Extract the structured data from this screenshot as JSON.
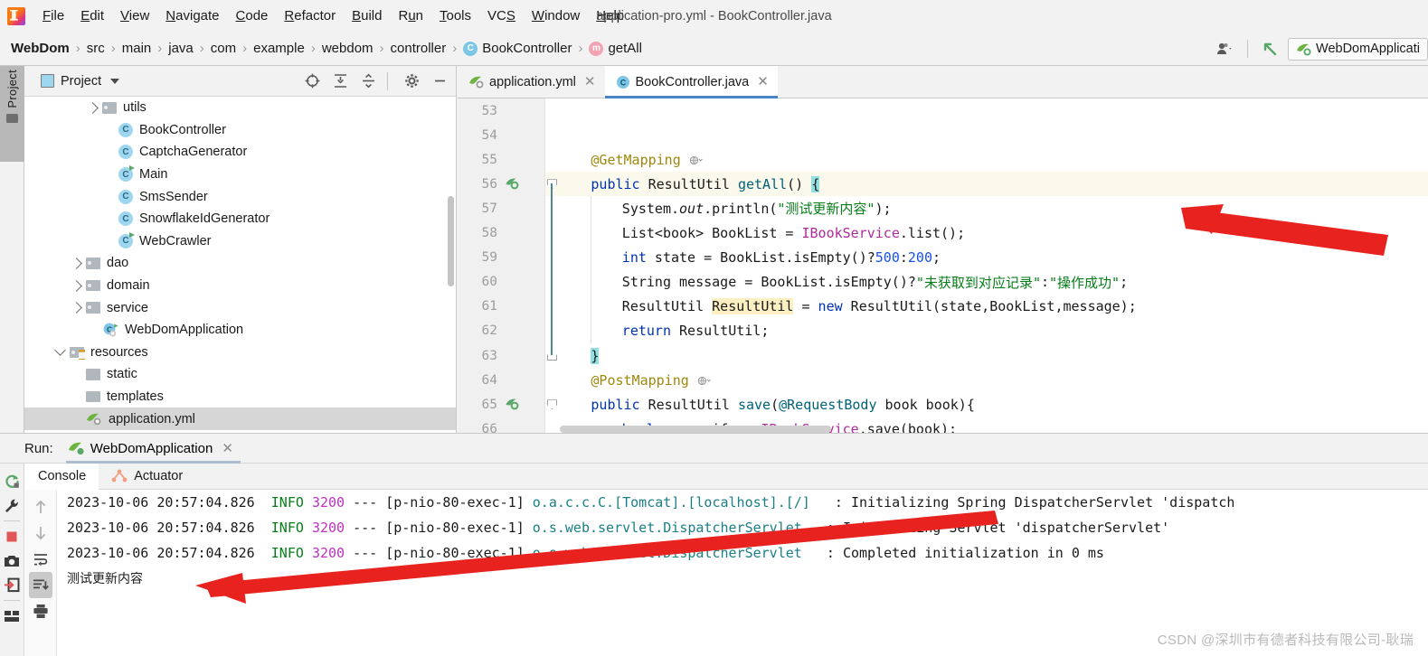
{
  "window": {
    "title": "application-pro.yml - BookController.java"
  },
  "menubar": {
    "items": [
      {
        "label": "File",
        "mnemonic": "F"
      },
      {
        "label": "Edit",
        "mnemonic": "E"
      },
      {
        "label": "View",
        "mnemonic": "V"
      },
      {
        "label": "Navigate",
        "mnemonic": "N"
      },
      {
        "label": "Code",
        "mnemonic": "C"
      },
      {
        "label": "Refactor",
        "mnemonic": "R"
      },
      {
        "label": "Build",
        "mnemonic": "B"
      },
      {
        "label": "Run",
        "mnemonic": "u"
      },
      {
        "label": "Tools",
        "mnemonic": "T"
      },
      {
        "label": "VCS",
        "mnemonic": "S"
      },
      {
        "label": "Window",
        "mnemonic": "W"
      },
      {
        "label": "Help",
        "mnemonic": "H"
      }
    ]
  },
  "breadcrumb": {
    "items": [
      {
        "label": "WebDom",
        "type": "project"
      },
      {
        "label": "src",
        "type": "folder"
      },
      {
        "label": "main",
        "type": "folder"
      },
      {
        "label": "java",
        "type": "folder"
      },
      {
        "label": "com",
        "type": "package"
      },
      {
        "label": "example",
        "type": "package"
      },
      {
        "label": "webdom",
        "type": "package"
      },
      {
        "label": "controller",
        "type": "package"
      },
      {
        "label": "BookController",
        "type": "class",
        "badge": "C"
      },
      {
        "label": "getAll",
        "type": "method",
        "badge": "m"
      }
    ],
    "separator": "›"
  },
  "toolbar_right": {
    "user_icon": "user-account-icon",
    "vcs_update_icon": "vcs-update-arrow-icon",
    "run_config": "WebDomApplicati"
  },
  "tool_strip": {
    "project_label": "Project",
    "folder_icon": "folder-icon"
  },
  "project_panel": {
    "title": "Project",
    "icons": [
      "locate-target-icon",
      "expand-all-icon",
      "collapse-all-icon",
      "settings-gear-icon",
      "minimize-icon"
    ],
    "tree": [
      {
        "label": "utils",
        "type": "folder",
        "indent": 4,
        "arrow": "collapsed"
      },
      {
        "label": "BookController",
        "type": "class",
        "indent": 5,
        "runnable": false
      },
      {
        "label": "CaptchaGenerator",
        "type": "class",
        "indent": 5,
        "runnable": false
      },
      {
        "label": "Main",
        "type": "class",
        "indent": 5,
        "runnable": true
      },
      {
        "label": "SmsSender",
        "type": "class",
        "indent": 5,
        "runnable": false
      },
      {
        "label": "SnowflakeIdGenerator",
        "type": "class",
        "indent": 5,
        "runnable": false
      },
      {
        "label": "WebCrawler",
        "type": "class",
        "indent": 5,
        "runnable": true
      },
      {
        "label": "dao",
        "type": "folder",
        "indent": 3,
        "arrow": "collapsed"
      },
      {
        "label": "domain",
        "type": "folder",
        "indent": 3,
        "arrow": "collapsed"
      },
      {
        "label": "service",
        "type": "folder",
        "indent": 3,
        "arrow": "collapsed"
      },
      {
        "label": "WebDomApplication",
        "type": "spring-class",
        "indent": 4,
        "runnable": true
      },
      {
        "label": "resources",
        "type": "resource-folder",
        "indent": 2,
        "arrow": "expanded"
      },
      {
        "label": "static",
        "type": "folder-plain",
        "indent": 3
      },
      {
        "label": "templates",
        "type": "folder-plain",
        "indent": 3
      },
      {
        "label": "application.yml",
        "type": "spring-yml",
        "indent": 3,
        "selected": true
      }
    ]
  },
  "editor": {
    "tabs": [
      {
        "label": "application.yml",
        "icon": "spring-yml-icon",
        "active": false,
        "closable": true
      },
      {
        "label": "BookController.java",
        "icon": "java-class-icon",
        "active": true,
        "closable": true
      }
    ],
    "first_line_number": 53,
    "current_line": 56,
    "lines": [
      {
        "num": 53,
        "tokens": []
      },
      {
        "num": 54,
        "tokens": []
      },
      {
        "num": 55,
        "indent": 4,
        "tokens": [
          {
            "t": "@GetMapping",
            "c": "anno"
          },
          {
            "t": " ",
            "c": "plain"
          },
          {
            "t": "ⓦ⌄",
            "c": "gutter-web"
          }
        ]
      },
      {
        "num": 56,
        "indent": 4,
        "highlight": true,
        "gutter_icon": "spring-request-mapping-icon",
        "fold": "start",
        "tokens": [
          {
            "t": "public",
            "c": "kw"
          },
          {
            "t": " ResultUtil ",
            "c": "cls"
          },
          {
            "t": "getAll",
            "c": "mname"
          },
          {
            "t": "() ",
            "c": "plain"
          },
          {
            "t": "{",
            "c": "brace-hl"
          }
        ]
      },
      {
        "num": 57,
        "indent": 8,
        "tokens": [
          {
            "t": "System.",
            "c": "plain"
          },
          {
            "t": "out",
            "c": "fld-static"
          },
          {
            "t": ".println(",
            "c": "plain"
          },
          {
            "t": "\"测试更新内容\"",
            "c": "str"
          },
          {
            "t": ");",
            "c": "plain"
          }
        ]
      },
      {
        "num": 58,
        "indent": 8,
        "tokens": [
          {
            "t": "List<book> BookList = ",
            "c": "plain"
          },
          {
            "t": "IBookService",
            "c": "iface"
          },
          {
            "t": ".list();",
            "c": "plain"
          }
        ]
      },
      {
        "num": 59,
        "indent": 8,
        "tokens": [
          {
            "t": "int",
            "c": "kw"
          },
          {
            "t": " state = BookList.isEmpty()?",
            "c": "plain"
          },
          {
            "t": "500",
            "c": "num"
          },
          {
            "t": ":",
            "c": "plain"
          },
          {
            "t": "200",
            "c": "num"
          },
          {
            "t": ";",
            "c": "plain"
          }
        ]
      },
      {
        "num": 60,
        "indent": 8,
        "tokens": [
          {
            "t": "String message = BookList.isEmpty()?",
            "c": "plain"
          },
          {
            "t": "\"未获取到对应记录\"",
            "c": "str"
          },
          {
            "t": ":",
            "c": "plain"
          },
          {
            "t": "\"操作成功\"",
            "c": "str"
          },
          {
            "t": ";",
            "c": "plain"
          }
        ]
      },
      {
        "num": 61,
        "indent": 8,
        "tokens": [
          {
            "t": "ResultUtil ",
            "c": "plain"
          },
          {
            "t": "ResultUtil",
            "c": "ident-hl"
          },
          {
            "t": " = ",
            "c": "plain"
          },
          {
            "t": "new",
            "c": "kw"
          },
          {
            "t": " ResultUtil(state,BookList,message);",
            "c": "plain"
          }
        ]
      },
      {
        "num": 62,
        "indent": 8,
        "tokens": [
          {
            "t": "return",
            "c": "kw"
          },
          {
            "t": " ResultUtil;",
            "c": "plain"
          }
        ]
      },
      {
        "num": 63,
        "indent": 4,
        "fold": "end",
        "tokens": [
          {
            "t": "}",
            "c": "brace-hl"
          }
        ]
      },
      {
        "num": 64,
        "indent": 4,
        "tokens": [
          {
            "t": "@PostMapping",
            "c": "anno"
          },
          {
            "t": " ",
            "c": "plain"
          },
          {
            "t": "ⓦ⌄",
            "c": "gutter-web"
          }
        ]
      },
      {
        "num": 65,
        "indent": 4,
        "gutter_icon": "spring-request-mapping-icon",
        "fold": "start",
        "tokens": [
          {
            "t": "public",
            "c": "kw"
          },
          {
            "t": " ResultUtil ",
            "c": "cls"
          },
          {
            "t": "save",
            "c": "mname"
          },
          {
            "t": "(",
            "c": "plain"
          },
          {
            "t": "@RequestBody",
            "c": "mname"
          },
          {
            "t": " book book){",
            "c": "plain"
          }
        ]
      },
      {
        "num": 66,
        "indent": 8,
        "tokens": [
          {
            "t": "boolean",
            "c": "kw"
          },
          {
            "t": " verify = ",
            "c": "plain"
          },
          {
            "t": "IBookService",
            "c": "iface"
          },
          {
            "t": ".save(book);",
            "c": "plain"
          }
        ]
      }
    ]
  },
  "run_panel": {
    "label": "Run:",
    "tab": {
      "label": "WebDomApplication",
      "icon": "spring-boot-running-icon",
      "closable": true
    },
    "side_buttons": [
      "rerun-icon",
      "wrench-settings-icon",
      "stop-icon",
      "camera-screenshot-icon",
      "exit-dump-icon",
      "layout-icon"
    ],
    "console_tabs": [
      {
        "label": "Console",
        "active": true
      },
      {
        "label": "Actuator",
        "active": false,
        "icon": "actuator-graph-icon"
      }
    ],
    "console_toolbar": [
      "scroll-up-icon",
      "scroll-down-icon",
      "soft-wrap-icon",
      "scroll-to-end-icon",
      "print-icon"
    ],
    "logs": [
      {
        "time": "2023-10-06 20:57:04.826",
        "level": "INFO",
        "pid": "3200",
        "dash": "---",
        "thread": "[p-nio-80-exec-1]",
        "logger": "o.a.c.c.C.[Tomcat].[localhost].[/]",
        "sep": ":",
        "message": "Initializing Spring DispatcherServlet 'dispatch"
      },
      {
        "time": "2023-10-06 20:57:04.826",
        "level": "INFO",
        "pid": "3200",
        "dash": "---",
        "thread": "[p-nio-80-exec-1]",
        "logger": "o.s.web.servlet.DispatcherServlet",
        "sep": ":",
        "message": "Initializing Servlet 'dispatcherServlet'"
      },
      {
        "time": "2023-10-06 20:57:04.826",
        "level": "INFO",
        "pid": "3200",
        "dash": "---",
        "thread": "[p-nio-80-exec-1]",
        "logger": "o.s.web.servlet.DispatcherServlet",
        "sep": ":",
        "message": "Completed initialization in 0 ms"
      }
    ],
    "program_output": "测试更新内容"
  },
  "annotations": {
    "arrow_color": "#e8231f",
    "arrow_code_label": "points-to-println-line",
    "arrow_console_label": "points-to-console-output"
  },
  "watermark": {
    "text": "CSDN @深圳市有德者科技有限公司-耿瑞"
  },
  "colors": {
    "accent_tab": "#4a86c7",
    "keyword": "#0033b3",
    "string": "#067d17",
    "number": "#1750eb",
    "annotation": "#9e880d",
    "interface": "#b02a9b",
    "current_line_bg": "#fbf8ec",
    "selection_bg": "#d6d6d6"
  }
}
